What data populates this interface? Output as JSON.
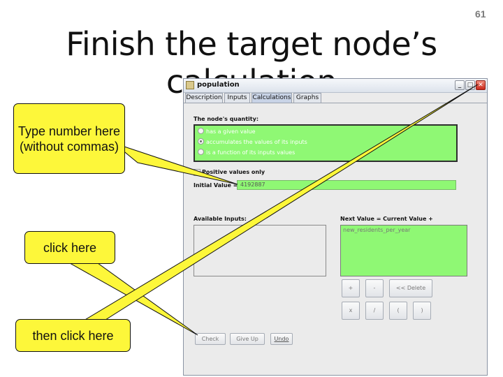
{
  "slide": {
    "number": "61",
    "title": "Finish the target node’s calculation"
  },
  "window": {
    "title": "population",
    "controls": {
      "minimize": "_",
      "maximize": "□",
      "close": "✕"
    },
    "tabs": [
      {
        "label": "Description",
        "selected": false
      },
      {
        "label": "Inputs",
        "selected": false
      },
      {
        "label": "Calculations",
        "selected": true
      },
      {
        "label": "Graphs",
        "selected": false
      }
    ],
    "quantity_label": "The node's quantity:",
    "quantity_options": [
      {
        "label": "has a given value",
        "selected": false
      },
      {
        "label": "accumulates the values of its inputs",
        "selected": true
      },
      {
        "label": "is a function of its inputs values",
        "selected": false
      }
    ],
    "positive_only_label": "Positive values only",
    "initial_value_label": "Initial Value =",
    "initial_value": "4192887",
    "available_inputs_label": "Available Inputs:",
    "next_value_label": "Next Value = Current Value +",
    "next_value_expression": "new_residents_per_year",
    "operator_buttons": [
      "+",
      "-",
      "<< Delete",
      "x",
      "/",
      "(",
      ")"
    ],
    "bottom_buttons": {
      "check": "Check",
      "give_up": "Give Up",
      "undo": "Undo"
    }
  },
  "callouts": {
    "type_number": "Type number here (without commas)",
    "click_here": "click here",
    "then_click_here": "then click here"
  },
  "colors": {
    "green_fill": "#8ff874",
    "callout_yellow": "#fdf73a",
    "close_red": "#c9281a"
  }
}
